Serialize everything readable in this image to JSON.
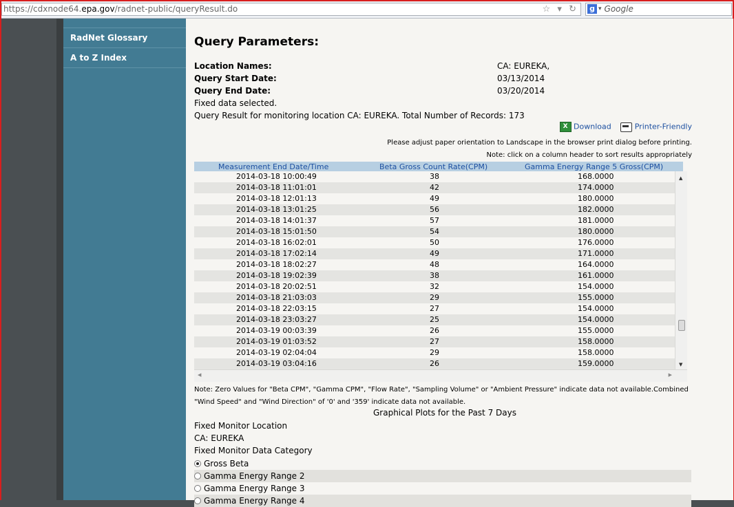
{
  "browser": {
    "url_prefix": "https://cdxnode64.",
    "url_host": "epa.gov",
    "url_path": "/radnet-public/queryResult.do",
    "search_placeholder": "Google"
  },
  "nav": {
    "items": [
      {
        "label": "RadNet Glossary"
      },
      {
        "label": "A to Z Index"
      }
    ]
  },
  "query": {
    "title": "Query Parameters:",
    "location_label": "Location Names:",
    "location_value": "CA: EUREKA,",
    "start_label": "Query Start Date:",
    "start_value": "03/13/2014",
    "end_label": "Query End Date:",
    "end_value": "03/20/2014",
    "fixed_selected": "Fixed data selected.",
    "result_summary": "Query Result for monitoring location CA: EUREKA. Total Number of Records: 173"
  },
  "actions": {
    "download": "Download",
    "print": "Printer-Friendly",
    "landscape_note": "Please adjust paper orientation to Landscape in the browser print dialog before printing.",
    "sort_note": "Note: click on a column header to sort results appropriately"
  },
  "table": {
    "headers": [
      "Measurement End Date/Time",
      "Beta Gross Count Rate(CPM)",
      "Gamma Energy Range 5 Gross(CPM)"
    ],
    "rows": [
      [
        "2014-03-18 10:00:49",
        "38",
        "168.0000"
      ],
      [
        "2014-03-18 11:01:01",
        "42",
        "174.0000"
      ],
      [
        "2014-03-18 12:01:13",
        "49",
        "180.0000"
      ],
      [
        "2014-03-18 13:01:25",
        "56",
        "182.0000"
      ],
      [
        "2014-03-18 14:01:37",
        "57",
        "181.0000"
      ],
      [
        "2014-03-18 15:01:50",
        "54",
        "180.0000"
      ],
      [
        "2014-03-18 16:02:01",
        "50",
        "176.0000"
      ],
      [
        "2014-03-18 17:02:14",
        "49",
        "171.0000"
      ],
      [
        "2014-03-18 18:02:27",
        "48",
        "164.0000"
      ],
      [
        "2014-03-18 19:02:39",
        "38",
        "161.0000"
      ],
      [
        "2014-03-18 20:02:51",
        "32",
        "154.0000"
      ],
      [
        "2014-03-18 21:03:03",
        "29",
        "155.0000"
      ],
      [
        "2014-03-18 22:03:15",
        "27",
        "154.0000"
      ],
      [
        "2014-03-18 23:03:27",
        "25",
        "154.0000"
      ],
      [
        "2014-03-19 00:03:39",
        "26",
        "155.0000"
      ],
      [
        "2014-03-19 01:03:52",
        "27",
        "158.0000"
      ],
      [
        "2014-03-19 02:04:04",
        "29",
        "158.0000"
      ],
      [
        "2014-03-19 03:04:16",
        "26",
        "159.0000"
      ]
    ]
  },
  "footnote": "Note: Zero Values for \"Beta CPM\", \"Gamma CPM\", \"Flow Rate\", \"Sampling Volume\" or \"Ambient Pressure\" indicate data not available.Combined \"Wind Speed\" and \"Wind Direction\" of '0' and '359' indicate data not available.",
  "plots": {
    "title": "Graphical Plots for the Past 7 Days",
    "location_heading": "Fixed Monitor Location",
    "location_value": "CA: EUREKA",
    "category_heading": "Fixed Monitor Data Category",
    "options": [
      {
        "label": "Gross Beta",
        "selected": true
      },
      {
        "label": "Gamma Energy Range 2",
        "selected": false
      },
      {
        "label": "Gamma Energy Range 3",
        "selected": false
      },
      {
        "label": "Gamma Energy Range 4",
        "selected": false
      }
    ]
  }
}
